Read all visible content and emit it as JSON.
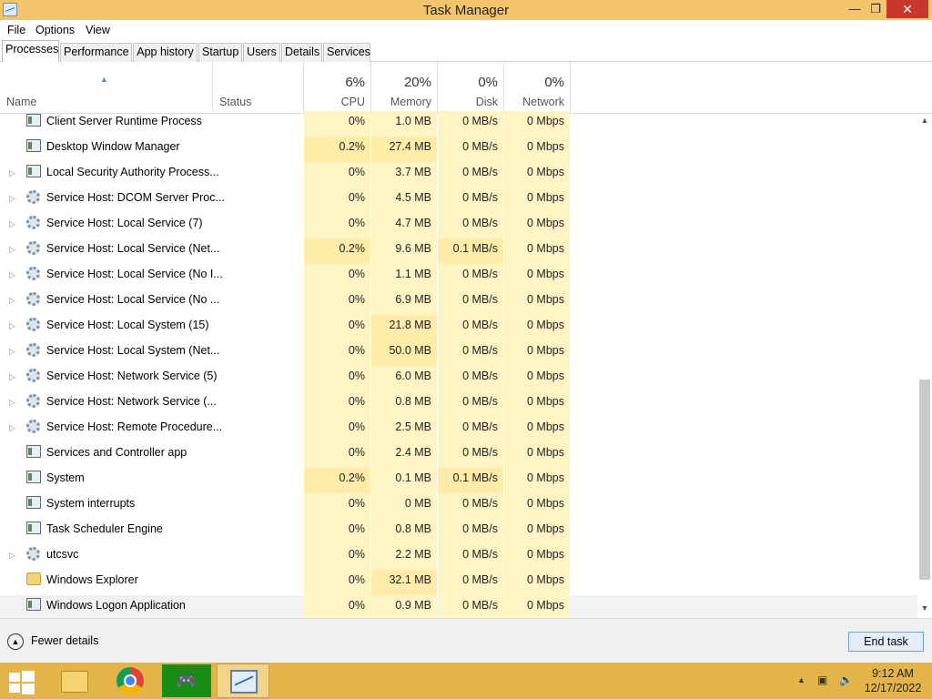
{
  "window": {
    "title": "Task Manager",
    "controls": {
      "minimize": "—",
      "maximize": "❐",
      "close": "✕"
    }
  },
  "menu": [
    "File",
    "Options",
    "View"
  ],
  "tabs": [
    {
      "label": "Processes",
      "active": true
    },
    {
      "label": "Performance"
    },
    {
      "label": "App history"
    },
    {
      "label": "Startup"
    },
    {
      "label": "Users"
    },
    {
      "label": "Details"
    },
    {
      "label": "Services"
    }
  ],
  "columns": {
    "name": "Name",
    "status": "Status",
    "cpu": {
      "pct": "6%",
      "label": "CPU"
    },
    "memory": {
      "pct": "20%",
      "label": "Memory"
    },
    "disk": {
      "pct": "0%",
      "label": "Disk"
    },
    "network": {
      "pct": "0%",
      "label": "Network"
    },
    "sort_icon": "sort-ascending-icon"
  },
  "processes": [
    {
      "name": "Client Server Runtime Process",
      "icon": "window",
      "expandable": false,
      "cpu": "0%",
      "memory": "1.0 MB",
      "disk": "0 MB/s",
      "network": "0 Mbps"
    },
    {
      "name": "Desktop Window Manager",
      "icon": "window",
      "expandable": false,
      "cpu": "0.2%",
      "memory": "27.4 MB",
      "disk": "0 MB/s",
      "network": "0 Mbps"
    },
    {
      "name": "Local Security Authority Process...",
      "icon": "window",
      "expandable": true,
      "cpu": "0%",
      "memory": "3.7 MB",
      "disk": "0 MB/s",
      "network": "0 Mbps"
    },
    {
      "name": "Service Host: DCOM Server Proc...",
      "icon": "gear",
      "expandable": true,
      "cpu": "0%",
      "memory": "4.5 MB",
      "disk": "0 MB/s",
      "network": "0 Mbps"
    },
    {
      "name": "Service Host: Local Service (7)",
      "icon": "gear",
      "expandable": true,
      "cpu": "0%",
      "memory": "4.7 MB",
      "disk": "0 MB/s",
      "network": "0 Mbps"
    },
    {
      "name": "Service Host: Local Service (Net...",
      "icon": "gear",
      "expandable": true,
      "cpu": "0.2%",
      "memory": "9.6 MB",
      "disk": "0.1 MB/s",
      "network": "0 Mbps"
    },
    {
      "name": "Service Host: Local Service (No I...",
      "icon": "gear",
      "expandable": true,
      "cpu": "0%",
      "memory": "1.1 MB",
      "disk": "0 MB/s",
      "network": "0 Mbps"
    },
    {
      "name": "Service Host: Local Service (No ...",
      "icon": "gear",
      "expandable": true,
      "cpu": "0%",
      "memory": "6.9 MB",
      "disk": "0 MB/s",
      "network": "0 Mbps"
    },
    {
      "name": "Service Host: Local System (15)",
      "icon": "gear",
      "expandable": true,
      "cpu": "0%",
      "memory": "21.8 MB",
      "disk": "0 MB/s",
      "network": "0 Mbps"
    },
    {
      "name": "Service Host: Local System (Net...",
      "icon": "gear",
      "expandable": true,
      "cpu": "0%",
      "memory": "50.0 MB",
      "disk": "0 MB/s",
      "network": "0 Mbps"
    },
    {
      "name": "Service Host: Network Service (5)",
      "icon": "gear",
      "expandable": true,
      "cpu": "0%",
      "memory": "6.0 MB",
      "disk": "0 MB/s",
      "network": "0 Mbps"
    },
    {
      "name": "Service Host: Network Service (...",
      "icon": "gear",
      "expandable": true,
      "cpu": "0%",
      "memory": "0.8 MB",
      "disk": "0 MB/s",
      "network": "0 Mbps"
    },
    {
      "name": "Service Host: Remote Procedure...",
      "icon": "gear",
      "expandable": true,
      "cpu": "0%",
      "memory": "2.5 MB",
      "disk": "0 MB/s",
      "network": "0 Mbps"
    },
    {
      "name": "Services and Controller app",
      "icon": "window",
      "expandable": false,
      "cpu": "0%",
      "memory": "2.4 MB",
      "disk": "0 MB/s",
      "network": "0 Mbps"
    },
    {
      "name": "System",
      "icon": "window",
      "expandable": false,
      "cpu": "0.2%",
      "memory": "0.1 MB",
      "disk": "0.1 MB/s",
      "network": "0 Mbps"
    },
    {
      "name": "System interrupts",
      "icon": "window",
      "expandable": false,
      "cpu": "0%",
      "memory": "0 MB",
      "disk": "0 MB/s",
      "network": "0 Mbps"
    },
    {
      "name": "Task Scheduler Engine",
      "icon": "window",
      "expandable": false,
      "cpu": "0%",
      "memory": "0.8 MB",
      "disk": "0 MB/s",
      "network": "0 Mbps"
    },
    {
      "name": "utcsvc",
      "icon": "gear",
      "expandable": true,
      "cpu": "0%",
      "memory": "2.2 MB",
      "disk": "0 MB/s",
      "network": "0 Mbps"
    },
    {
      "name": "Windows Explorer",
      "icon": "folder",
      "expandable": false,
      "cpu": "0%",
      "memory": "32.1 MB",
      "disk": "0 MB/s",
      "network": "0 Mbps"
    },
    {
      "name": "Windows Logon Application",
      "icon": "window",
      "expandable": false,
      "cpu": "0%",
      "memory": "0.9 MB",
      "disk": "0 MB/s",
      "network": "0 Mbps"
    }
  ],
  "footer": {
    "fewer_details": "Fewer details",
    "end_task": "End task"
  },
  "taskbar": {
    "apps": [
      "start-button",
      "file-explorer",
      "chrome",
      "xbox-games",
      "task-manager"
    ],
    "clock_time": "9:12 AM",
    "clock_date": "12/17/2022"
  },
  "colors": {
    "titlebar": "#f2c56d",
    "taskbar": "#e2b449",
    "heat_low": "#fff4c4",
    "heat_mid": "#ffeca8"
  }
}
